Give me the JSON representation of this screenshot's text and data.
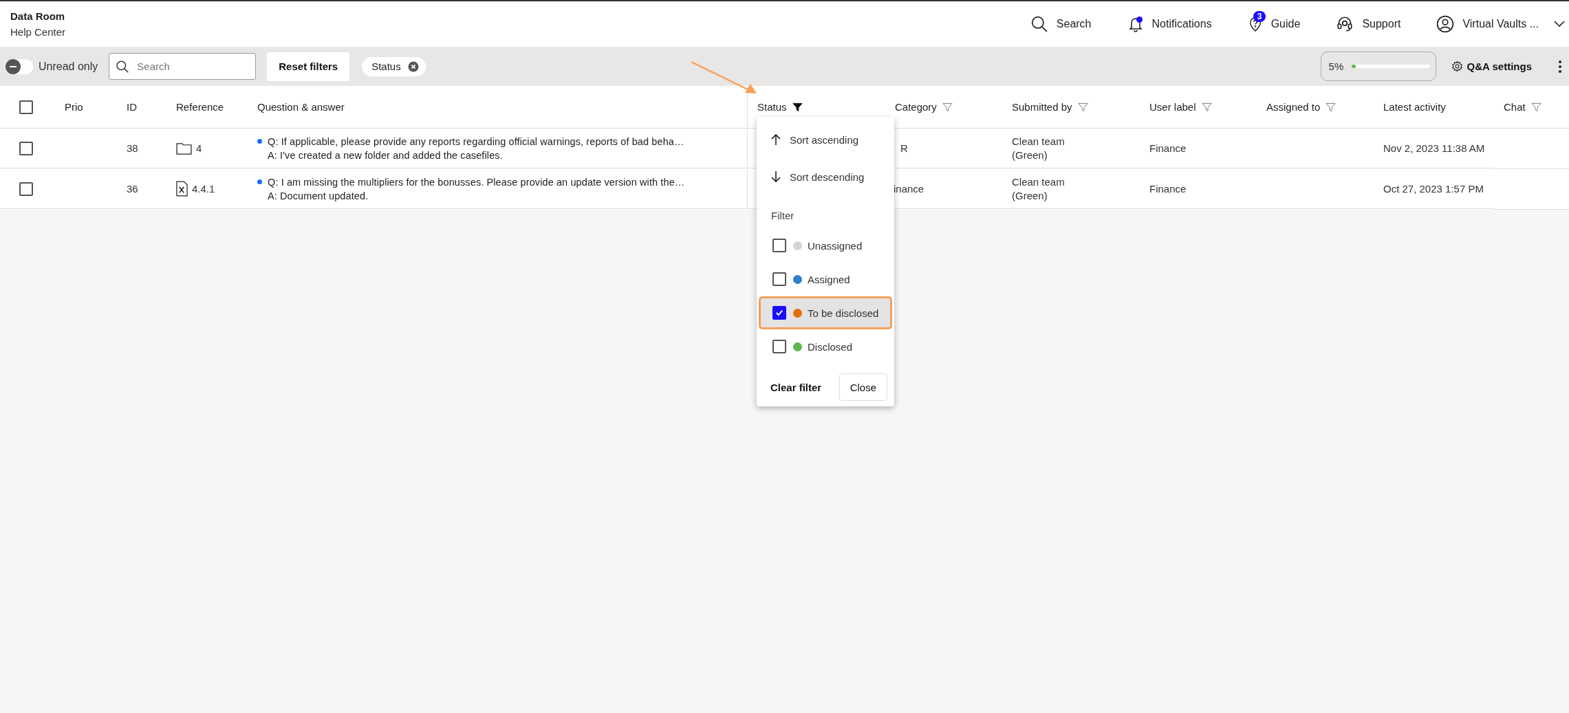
{
  "header": {
    "title": "Data Room",
    "subtitle": "Help Center",
    "nav": [
      {
        "kind": "search",
        "label": "Search"
      },
      {
        "kind": "notifications",
        "label": "Notifications",
        "dot": true
      },
      {
        "kind": "guide",
        "label": "Guide",
        "badge": "3"
      },
      {
        "kind": "support",
        "label": "Support"
      },
      {
        "kind": "account",
        "label": "Virtual Vaults ..."
      }
    ]
  },
  "toolbar": {
    "unread_only": {
      "label": "Unread only",
      "on": false
    },
    "search": {
      "placeholder": "Search"
    },
    "reset_button": "Reset filters",
    "filter_chips": [
      {
        "label": "Status"
      }
    ],
    "progress": {
      "reading": "5%",
      "level": 0.05
    },
    "settings_button": "Q&A settings"
  },
  "table": {
    "select_all": {
      "checked": false
    },
    "columns": [
      {
        "label": "Prio",
        "filterable": false,
        "filter_active": false
      },
      {
        "label": "ID",
        "filterable": false,
        "filter_active": false
      },
      {
        "label": "Reference",
        "filterable": false,
        "filter_active": false
      },
      {
        "label": "Question & answer",
        "filterable": false,
        "filter_active": false
      },
      {
        "label": "Status",
        "filterable": true,
        "filter_active": true
      },
      {
        "label": "Category",
        "filterable": true,
        "filter_active": false
      },
      {
        "label": "Submitted by",
        "filterable": true,
        "filter_active": false
      },
      {
        "label": "User label",
        "filterable": true,
        "filter_active": false
      },
      {
        "label": "Assigned to",
        "filterable": true,
        "filter_active": false
      },
      {
        "label": "Latest activity",
        "filterable": false,
        "filter_active": false
      },
      {
        "label": "Chat",
        "filterable": true,
        "filter_active": false
      }
    ],
    "rows": [
      {
        "selected": false,
        "id": "38",
        "kind": "folder",
        "reference": "4",
        "unread": true,
        "question": "Q: If applicable, please provide any reports regarding official warnings, reports of bad beha…",
        "answer": "A: I've created a new folder and added the casefiles.",
        "category": "R",
        "submitted_by": "Clean team (Green)",
        "user_label": "Finance",
        "latest_activity": "Nov 2, 2023 11:38 AM"
      },
      {
        "selected": false,
        "id": "36",
        "kind": "spreadsheet",
        "reference": "4.4.1",
        "unread": true,
        "question": "Q: I am missing the multipliers for the bonusses. Please provide an update version with the…",
        "answer": "A: Document updated.",
        "category": "inance",
        "submitted_by": "Clean team (Green)",
        "user_label": "Finance",
        "latest_activity": "Oct 27, 2023 1:57 PM"
      }
    ]
  },
  "status_menu": {
    "sort": [
      {
        "kind": "ascending",
        "label": "Sort ascending"
      },
      {
        "kind": "descending",
        "label": "Sort descending"
      }
    ],
    "filter_heading": "Filter",
    "options": [
      {
        "label": "Unassigned",
        "color": "#d4d4d2",
        "checked": false,
        "highlighted": false
      },
      {
        "label": "Assigned",
        "color": "#2f7fcc",
        "checked": false,
        "highlighted": false
      },
      {
        "label": "To be disclosed",
        "color": "#e46c0a",
        "checked": true,
        "highlighted": true
      },
      {
        "label": "Disclosed",
        "color": "#5cb84c",
        "checked": false,
        "highlighted": false
      }
    ],
    "clear_button": "Clear filter",
    "close_button": "Close"
  }
}
